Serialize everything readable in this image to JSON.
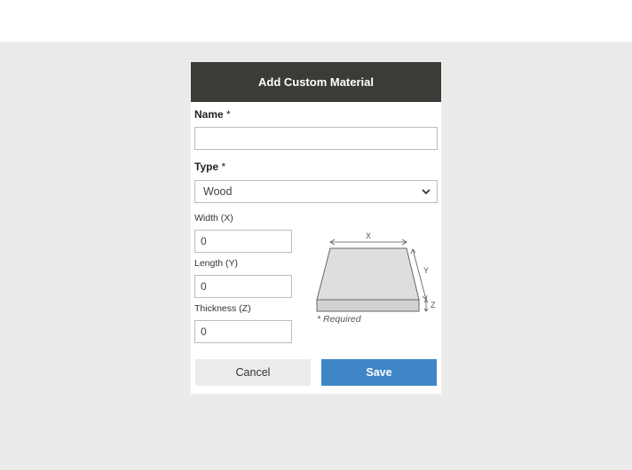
{
  "dialog": {
    "title": "Add Custom Material",
    "name": {
      "label": "Name",
      "required_mark": "*",
      "value": ""
    },
    "type": {
      "label": "Type",
      "required_mark": "*",
      "selected": "Wood"
    },
    "width": {
      "label": "Width (X)",
      "value": "0"
    },
    "length": {
      "label": "Length (Y)",
      "value": "0"
    },
    "thickness": {
      "label": "Thickness (Z)",
      "value": "0"
    },
    "diagram": {
      "x_label": "X",
      "y_label": "Y",
      "z_label": "Z"
    },
    "required_note": "* Required",
    "cancel_label": "Cancel",
    "save_label": "Save"
  },
  "colors": {
    "header_bg": "#3b3b37",
    "backdrop": "#ebebeb",
    "save_button": "#3f86c7",
    "cancel_button": "#ececec"
  },
  "icons": {
    "select_arrow": "chevron-down-icon"
  }
}
